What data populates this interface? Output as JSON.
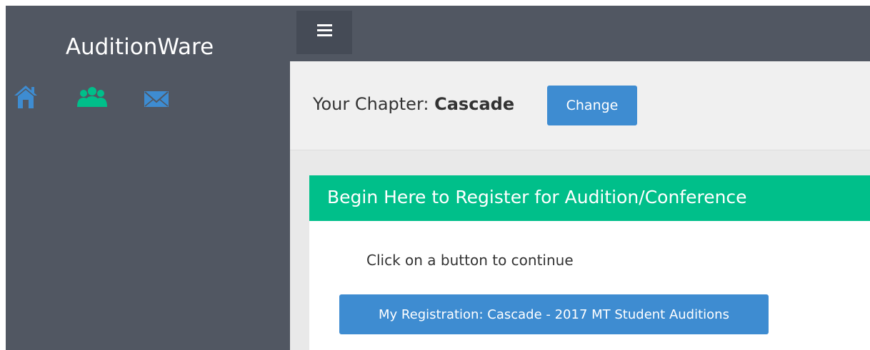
{
  "app": {
    "brand": "AuditionWare"
  },
  "sidebar": {
    "icons": [
      {
        "name": "home-icon",
        "color": "#3e8cd1"
      },
      {
        "name": "users-icon",
        "color": "#00bf8a"
      },
      {
        "name": "mail-icon",
        "color": "#3e8cd1"
      }
    ]
  },
  "topbar": {
    "menu_icon": "hamburger-menu-icon"
  },
  "chapter": {
    "prefix": "Your Chapter:",
    "name": "Cascade",
    "change_label": "Change"
  },
  "panel": {
    "title": "Begin Here to Register for Audition/Conference",
    "instruction": "Click on a button to continue",
    "registration_button": "My Registration: Cascade - 2017 MT Student Auditions"
  },
  "colors": {
    "sidebar": "#515762",
    "accent_blue": "#3e8cd1",
    "accent_green": "#00bf8a"
  }
}
